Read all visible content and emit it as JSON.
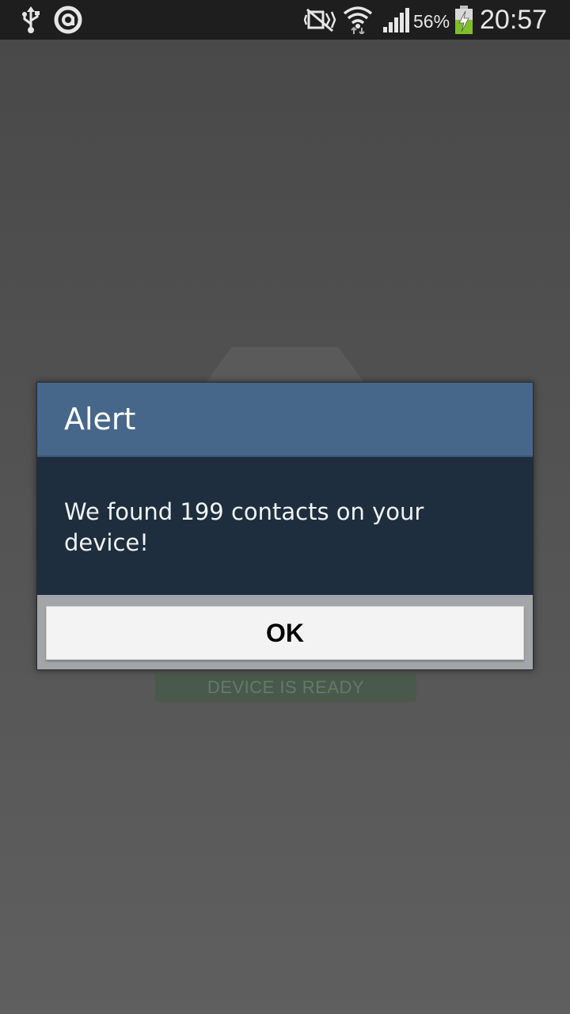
{
  "status_bar": {
    "icons": [
      "usb-icon",
      "app-notification-icon",
      "mute-icon",
      "wifi-icon",
      "signal-icon",
      "battery-charging-icon"
    ],
    "battery_percent": "56%",
    "time": "20:57"
  },
  "background_app": {
    "status_label": "DEVICE IS READY"
  },
  "dialog": {
    "title": "Alert",
    "message": "We found 199 contacts on your device!",
    "ok_label": "OK"
  },
  "colors": {
    "title_bar": "#46678a",
    "body": "#1e2e3f",
    "battery_charge": "#7fbf2a"
  }
}
